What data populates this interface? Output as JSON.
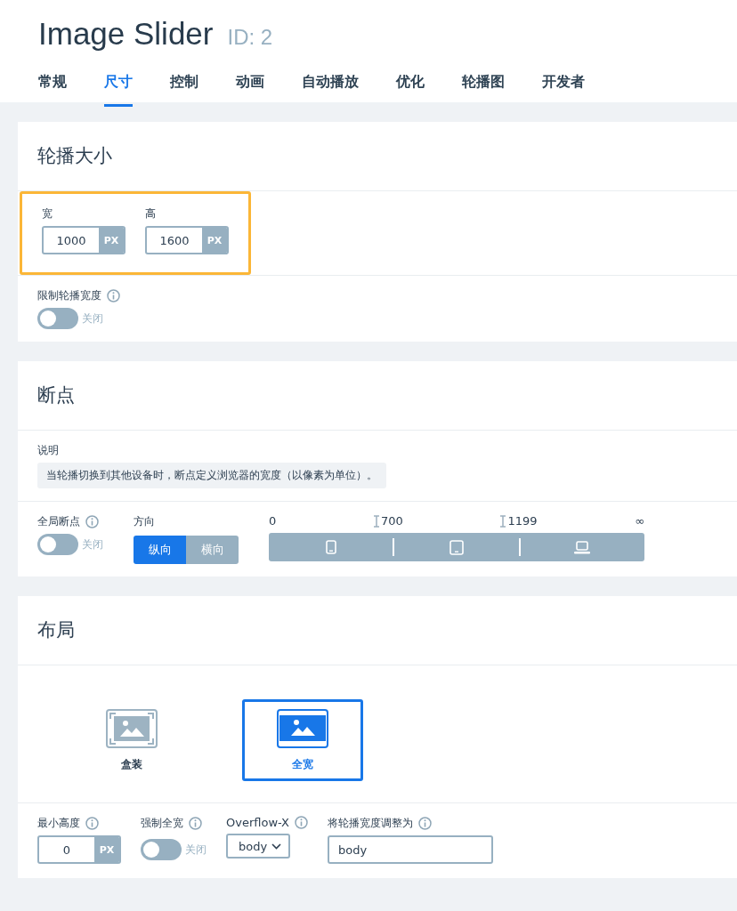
{
  "title": "Image Slider",
  "id_label": "ID: 2",
  "tabs": [
    {
      "label": "常规",
      "selected": false
    },
    {
      "label": "尺寸",
      "selected": true
    },
    {
      "label": "控制",
      "selected": false
    },
    {
      "label": "动画",
      "selected": false
    },
    {
      "label": "自动播放",
      "selected": false
    },
    {
      "label": "优化",
      "selected": false
    },
    {
      "label": "轮播图",
      "selected": false
    },
    {
      "label": "开发者",
      "selected": false
    }
  ],
  "size_section": {
    "title": "轮播大小",
    "highlighted": true,
    "fields": [
      {
        "label": "宽",
        "value": "1000",
        "unit": "PX"
      },
      {
        "label": "高",
        "value": "1600",
        "unit": "PX"
      }
    ],
    "limit_width": {
      "label": "限制轮播宽度",
      "on": false,
      "state_text": "关闭"
    }
  },
  "breakpoints_section": {
    "title": "断点",
    "note_label": "说明",
    "note": "当轮播切换到其他设备时，断点定义浏览器的宽度（以像素为单位）。",
    "global": {
      "label": "全局断点",
      "on": false,
      "state_text": "关闭"
    },
    "direction": {
      "label": "方向",
      "options": [
        {
          "label": "纵向",
          "selected": true
        },
        {
          "label": "横向",
          "selected": false
        }
      ]
    },
    "scale": {
      "marks": [
        {
          "label": "0",
          "kind": "plain"
        },
        {
          "label": "700",
          "kind": "handle"
        },
        {
          "label": "1199",
          "kind": "handle"
        },
        {
          "label": "∞",
          "kind": "plain"
        }
      ],
      "devices": [
        {
          "kind": "phone"
        },
        {
          "kind": "tablet"
        },
        {
          "kind": "laptop"
        }
      ]
    }
  },
  "layout_section": {
    "title": "布局",
    "options": [
      {
        "label": "盒装",
        "kind": "boxed",
        "selected": false
      },
      {
        "label": "全宽",
        "kind": "full",
        "selected": true
      }
    ],
    "min_height": {
      "label": "最小高度",
      "value": "0",
      "unit": "PX"
    },
    "force_full": {
      "label": "强制全宽",
      "on": false,
      "state_text": "关闭"
    },
    "overflow": {
      "label": "Overflow-X",
      "value": "body"
    },
    "adjust": {
      "label": "将轮播宽度调整为",
      "value": "body"
    }
  }
}
